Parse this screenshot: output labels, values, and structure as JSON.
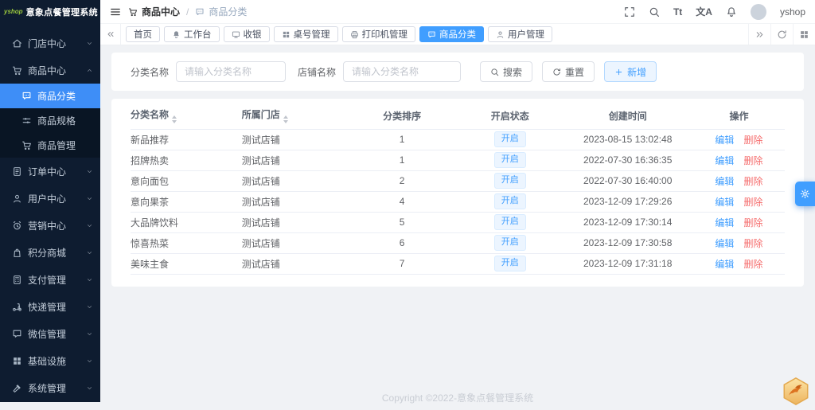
{
  "app": {
    "logo_text": "yshop",
    "title": "意象点餐管理系统"
  },
  "colors": {
    "primary": "#409eff",
    "sidebar_bg": "#0e1c30",
    "submenu_bg": "#091524",
    "content_bg": "#f0f2f5",
    "danger": "#f56c6c",
    "tag_bg": "#ecf5ff",
    "logo_green": "#9bc93d"
  },
  "sidebar": {
    "items": [
      {
        "key": "store-center",
        "label": "门店中心",
        "icon": "home",
        "expanded": false
      },
      {
        "key": "product-center",
        "label": "商品中心",
        "icon": "cart",
        "expanded": true,
        "children": [
          {
            "key": "product-category",
            "label": "商品分类",
            "icon": "comment",
            "active": true
          },
          {
            "key": "product-spec",
            "label": "商品规格",
            "icon": "sliders",
            "active": false
          },
          {
            "key": "product-manage",
            "label": "商品管理",
            "icon": "cart",
            "active": false
          }
        ]
      },
      {
        "key": "order-center",
        "label": "订单中心",
        "icon": "doc",
        "expanded": false
      },
      {
        "key": "user-center",
        "label": "用户中心",
        "icon": "user",
        "expanded": false
      },
      {
        "key": "marketing-center",
        "label": "营销中心",
        "icon": "alarm",
        "expanded": false
      },
      {
        "key": "points-mall",
        "label": "积分商城",
        "icon": "bag",
        "expanded": false
      },
      {
        "key": "payment-mgmt",
        "label": "支付管理",
        "icon": "calc",
        "expanded": false
      },
      {
        "key": "express-mgmt",
        "label": "快递管理",
        "icon": "scooter",
        "expanded": false
      },
      {
        "key": "wechat-mgmt",
        "label": "微信管理",
        "icon": "chat",
        "expanded": false
      },
      {
        "key": "infrastructure",
        "label": "基础设施",
        "icon": "grid",
        "expanded": false
      },
      {
        "key": "system-mgmt",
        "label": "系统管理",
        "icon": "hammer",
        "expanded": false
      }
    ]
  },
  "header": {
    "breadcrumb": {
      "parent": "商品中心",
      "current": "商品分类",
      "separator": "/"
    },
    "font_icon_text": "Tt",
    "translate_icon_text": "文A",
    "user": "yshop"
  },
  "tabbar": {
    "tabs": [
      {
        "key": "home",
        "label": "首页",
        "icon": null,
        "active": false
      },
      {
        "key": "workbench",
        "label": "工作台",
        "icon": "bell-fill",
        "active": false
      },
      {
        "key": "cashier",
        "label": "收银",
        "icon": "monitor",
        "active": false
      },
      {
        "key": "table-mgmt",
        "label": "桌号管理",
        "icon": "grid",
        "active": false
      },
      {
        "key": "printer-mgmt",
        "label": "打印机管理",
        "icon": "printer",
        "active": false
      },
      {
        "key": "product-category",
        "label": "商品分类",
        "icon": "comment",
        "active": true
      },
      {
        "key": "user-mgmt",
        "label": "用户管理",
        "icon": "user",
        "active": false
      }
    ]
  },
  "filters": {
    "fields": [
      {
        "label": "分类名称",
        "placeholder": "请输入分类名称",
        "value": ""
      },
      {
        "label": "店铺名称",
        "placeholder": "请输入分类名称",
        "value": ""
      }
    ],
    "search_label": "搜索",
    "reset_label": "重置",
    "add_label": "新增"
  },
  "table": {
    "columns": [
      {
        "label": "分类名称",
        "sortable": true,
        "align": "left"
      },
      {
        "label": "所属门店",
        "sortable": true,
        "align": "left"
      },
      {
        "label": "分类排序",
        "sortable": false,
        "align": "center"
      },
      {
        "label": "开启状态",
        "sortable": false,
        "align": "center"
      },
      {
        "label": "创建时间",
        "sortable": false,
        "align": "center"
      },
      {
        "label": "操作",
        "sortable": false,
        "align": "center"
      }
    ],
    "rows": [
      {
        "name": "新品推荐",
        "store": "测试店铺",
        "sort": "1",
        "status": "开启",
        "created": "2023-08-15 13:02:48"
      },
      {
        "name": "招牌热卖",
        "store": "测试店铺",
        "sort": "1",
        "status": "开启",
        "created": "2022-07-30 16:36:35"
      },
      {
        "name": "意向面包",
        "store": "测试店铺",
        "sort": "2",
        "status": "开启",
        "created": "2022-07-30 16:40:00"
      },
      {
        "name": "意向果茶",
        "store": "测试店铺",
        "sort": "4",
        "status": "开启",
        "created": "2023-12-09 17:29:26"
      },
      {
        "name": "大品牌饮料",
        "store": "测试店铺",
        "sort": "5",
        "status": "开启",
        "created": "2023-12-09 17:30:14"
      },
      {
        "name": "惊喜热菜",
        "store": "测试店铺",
        "sort": "6",
        "status": "开启",
        "created": "2023-12-09 17:30:58"
      },
      {
        "name": "美味主食",
        "store": "测试店铺",
        "sort": "7",
        "status": "开启",
        "created": "2023-12-09 17:31:18"
      }
    ],
    "actions": {
      "edit": "编辑",
      "delete": "删除"
    }
  },
  "footer": {
    "copyright": "Copyright ©2022-意象点餐管理系统"
  }
}
